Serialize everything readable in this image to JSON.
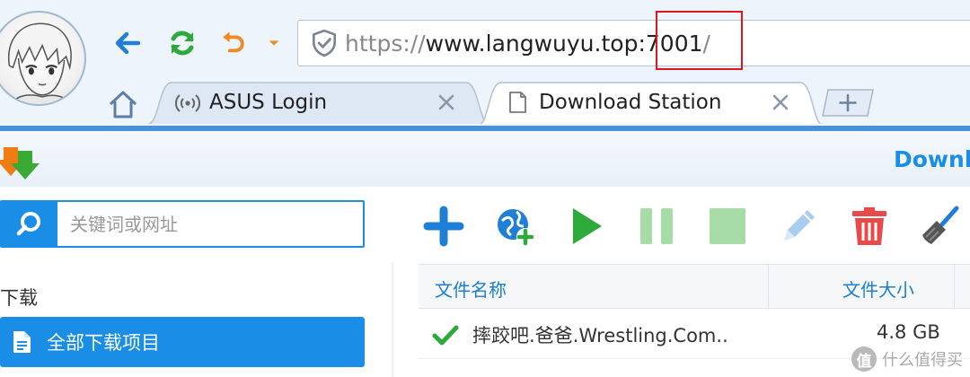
{
  "browser": {
    "url": {
      "scheme": "https://",
      "host": "www.langwuyu.top",
      "port": ":7001",
      "path": "/"
    },
    "tabs": [
      {
        "label": "ASUS Login",
        "icon": "wifi-icon",
        "active": false
      },
      {
        "label": "Download Station",
        "icon": "page-icon",
        "active": true
      }
    ],
    "highlight_color": "#e3161b"
  },
  "app": {
    "title": "Downl",
    "accent_color": "#1a8ee6",
    "search": {
      "placeholder": "关键词或网址"
    },
    "sidebar": {
      "section_label": "下载",
      "items": [
        {
          "label": "全部下载项目",
          "icon": "document-icon",
          "active": true
        }
      ]
    },
    "toolbar": [
      {
        "name": "add-icon"
      },
      {
        "name": "add-url-icon"
      },
      {
        "name": "play-icon"
      },
      {
        "name": "pause-icon"
      },
      {
        "name": "stop-icon"
      },
      {
        "name": "edit-icon"
      },
      {
        "name": "delete-icon"
      },
      {
        "name": "clear-icon"
      }
    ],
    "table": {
      "columns": [
        "文件名称",
        "文件大小"
      ],
      "rows": [
        {
          "status": "check-icon",
          "name": "摔跤吧.爸爸.Wrestling.Com..",
          "size": "4.8 GB"
        }
      ]
    }
  },
  "watermark": {
    "badge": "值",
    "text": "什么值得买"
  }
}
